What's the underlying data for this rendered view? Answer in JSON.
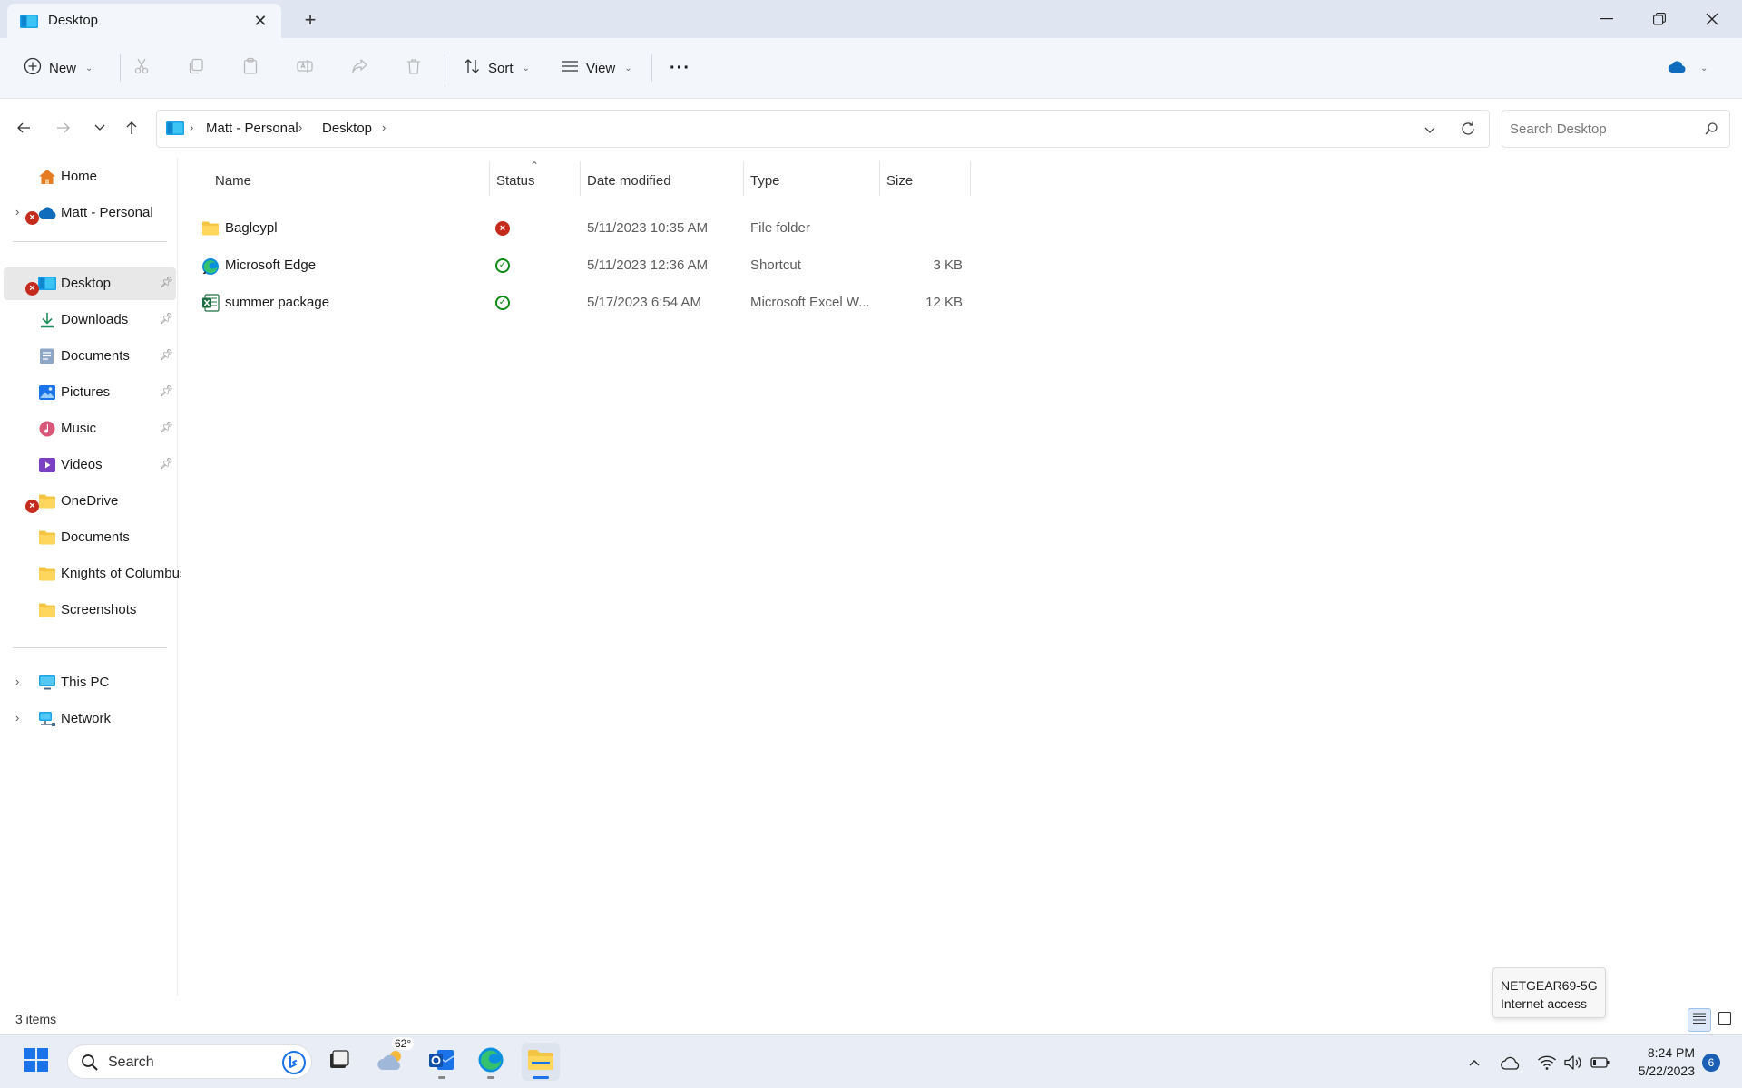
{
  "window": {
    "tab_title": "Desktop",
    "new_tab": "+"
  },
  "commandbar": {
    "new_label": "New",
    "sort_label": "Sort",
    "view_label": "View",
    "more_label": "···"
  },
  "address": {
    "crumbs": [
      "Matt - Personal",
      "Desktop"
    ],
    "search_placeholder": "Search Desktop"
  },
  "sidebar": {
    "home": "Home",
    "onedrive_personal": "Matt - Personal",
    "quick_access": [
      {
        "label": "Desktop",
        "icon": "desktop-icon"
      },
      {
        "label": "Downloads",
        "icon": "download-icon"
      },
      {
        "label": "Documents",
        "icon": "documents-icon"
      },
      {
        "label": "Pictures",
        "icon": "pictures-icon"
      },
      {
        "label": "Music",
        "icon": "music-icon"
      },
      {
        "label": "Videos",
        "icon": "videos-icon"
      }
    ],
    "onedrive": "OneDrive",
    "folders": [
      "Documents",
      "Knights of Columbus",
      "Screenshots"
    ],
    "this_pc": "This PC",
    "network": "Network"
  },
  "columns": {
    "name": "Name",
    "status": "Status",
    "date_modified": "Date modified",
    "type": "Type",
    "size": "Size"
  },
  "files": [
    {
      "name": "Bagleypl",
      "status": "error",
      "date": "5/11/2023 10:35 AM",
      "type": "File folder",
      "size": "",
      "icon": "folder-icon"
    },
    {
      "name": "Microsoft Edge",
      "status": "synced",
      "date": "5/11/2023 12:36 AM",
      "type": "Shortcut",
      "size": "3 KB",
      "icon": "edge-icon"
    },
    {
      "name": "summer package",
      "status": "synced",
      "date": "5/17/2023 6:54 AM",
      "type": "Microsoft Excel W...",
      "size": "12 KB",
      "icon": "excel-icon"
    }
  ],
  "statusbar": {
    "item_count": "3 items"
  },
  "tooltip": {
    "network_name": "NETGEAR69-5G",
    "network_status": "Internet access"
  },
  "taskbar": {
    "search_label": "Search",
    "weather_temp": "62°",
    "time": "8:24 PM",
    "date": "5/22/2023",
    "notification_count": "6"
  },
  "colors": {
    "accent": "#0078d4",
    "error": "#c42b1c",
    "synced": "#0e8a16",
    "folder": "#f4c542"
  }
}
